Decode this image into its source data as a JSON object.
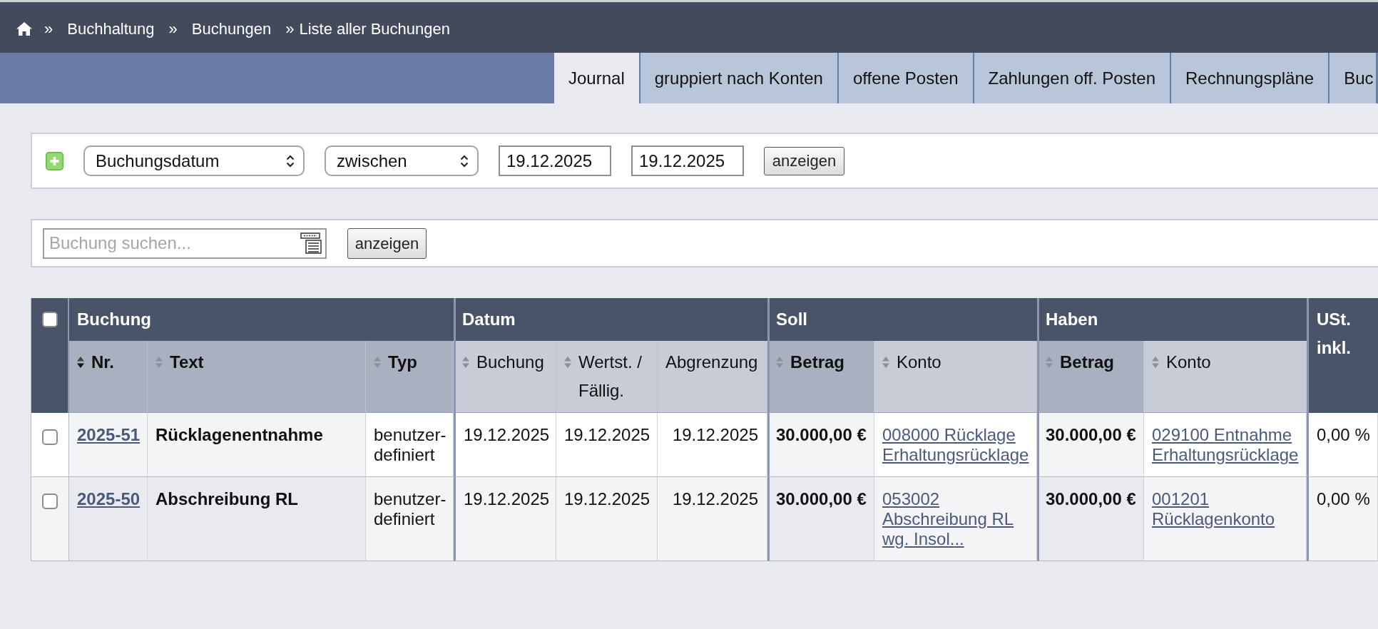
{
  "breadcrumb": [
    {
      "separator": "»",
      "label": "Buchhaltung"
    },
    {
      "separator": "»",
      "label": "Buchungen"
    },
    {
      "separator": "»",
      "label": "Liste aller Buchungen"
    }
  ],
  "tabs": [
    {
      "label": "Journal",
      "selected": true
    },
    {
      "label": "gruppiert nach Konten",
      "selected": false
    },
    {
      "label": "offene Posten",
      "selected": false
    },
    {
      "label": "Zahlungen off. Posten",
      "selected": false
    },
    {
      "label": "Rechnungspläne",
      "selected": false
    },
    {
      "label": "Buc",
      "selected": false
    }
  ],
  "filter": {
    "field": "Buchungsdatum",
    "operator": "zwischen",
    "date_from": "19.12.2025",
    "date_to": "19.12.2025",
    "button": "anzeigen"
  },
  "search": {
    "placeholder": "Buchung suchen...",
    "button": "anzeigen"
  },
  "table": {
    "select_all": {
      "checked": false
    },
    "groups": [
      {
        "label": "Buchung",
        "columns": [
          {
            "label": "Nr.",
            "highlighted": true,
            "sortable": true,
            "sorted": true
          },
          {
            "label": "Text",
            "highlighted": true,
            "sortable": true,
            "sorted": false
          },
          {
            "label": "Typ",
            "highlighted": true,
            "sortable": true,
            "sorted": false
          }
        ]
      },
      {
        "label": "Datum",
        "columns": [
          {
            "label": "Buchung",
            "highlighted": false,
            "sortable": true,
            "sorted": false
          },
          {
            "label": "Wertst. / Fällig.",
            "highlighted": false,
            "sortable": true,
            "sorted": false
          },
          {
            "label": "Abgrenzung",
            "highlighted": false,
            "sortable": false
          }
        ]
      },
      {
        "label": "Soll",
        "columns": [
          {
            "label": "Betrag",
            "highlighted": true,
            "sortable": true,
            "sorted": false
          },
          {
            "label": "Konto",
            "highlighted": false,
            "sortable": true,
            "sorted": false
          }
        ]
      },
      {
        "label": "Haben",
        "columns": [
          {
            "label": "Betrag",
            "highlighted": true,
            "sortable": true,
            "sorted": false
          },
          {
            "label": "Konto",
            "highlighted": false,
            "sortable": true,
            "sorted": false
          }
        ]
      }
    ],
    "tax_column": {
      "label": "USt. inkl."
    },
    "rows": [
      {
        "checked": false,
        "cells": [
          {
            "kind": "entry_link",
            "text": "2025-51"
          },
          {
            "kind": "title",
            "text": "Rücklagenentnahme"
          },
          {
            "kind": "text",
            "text": "benutzer-definiert"
          },
          {
            "kind": "text",
            "text": "19.12.2025"
          },
          {
            "kind": "text",
            "text": "19.12.2025"
          },
          {
            "kind": "text_right",
            "text": "19.12.2025"
          },
          {
            "kind": "amount",
            "text": "30.000,00 €"
          },
          {
            "kind": "account_link",
            "text": "008000 Rücklage Erhaltungsrücklage"
          },
          {
            "kind": "amount",
            "text": "30.000,00 €"
          },
          {
            "kind": "account_link",
            "text": "029100 Entnahme Erhaltungsrücklage"
          },
          {
            "kind": "text",
            "text": "0,00 %"
          }
        ]
      },
      {
        "checked": false,
        "cells": [
          {
            "kind": "entry_link",
            "text": "2025-50"
          },
          {
            "kind": "title",
            "text": "Abschreibung RL"
          },
          {
            "kind": "text",
            "text": "benutzer-definiert"
          },
          {
            "kind": "text",
            "text": "19.12.2025"
          },
          {
            "kind": "text",
            "text": "19.12.2025"
          },
          {
            "kind": "text_right",
            "text": "19.12.2025"
          },
          {
            "kind": "amount",
            "text": "30.000,00 €"
          },
          {
            "kind": "account_link",
            "text": "053002 Abschreibung RL wg. Insol..."
          },
          {
            "kind": "amount",
            "text": "30.000,00 €"
          },
          {
            "kind": "account_link",
            "text": "001201 Rücklagenkonto"
          },
          {
            "kind": "text",
            "text": "0,00 %"
          }
        ]
      }
    ]
  }
}
